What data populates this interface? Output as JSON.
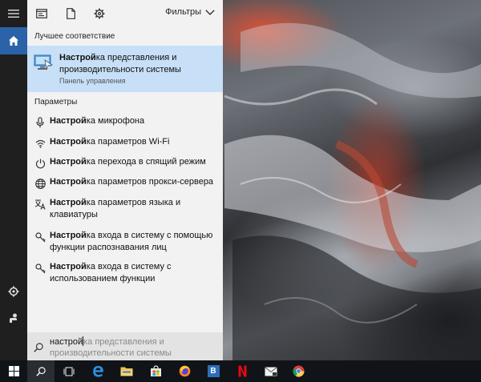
{
  "topbar": {
    "filters_label": "Фильтры"
  },
  "best_match": {
    "section_title": "Лучшее соответствие",
    "title_bold": "Настрой",
    "title_rest": "ка представления и производительности системы",
    "subtitle": "Панель управления"
  },
  "settings": {
    "section_title": "Параметры",
    "items": [
      {
        "bold": "Настрой",
        "rest": "ка микрофона"
      },
      {
        "bold": "Настрой",
        "rest": "ка параметров Wi-Fi"
      },
      {
        "bold": "Настрой",
        "rest": "ка перехода в спящий режим"
      },
      {
        "bold": "Настрой",
        "rest": "ка параметров прокси-сервера"
      },
      {
        "bold": "Настрой",
        "rest": "ка параметров языка и клавиатуры"
      },
      {
        "bold": "Настрой",
        "rest": "ка входа в систему с помощью функции распознавания лиц"
      },
      {
        "bold": "Настрой",
        "rest": "ка входа в систему с использованием функции"
      }
    ]
  },
  "search": {
    "typed": "настрой",
    "ghost": "ка представления и производительности системы"
  },
  "taskbar": {
    "pinned_letter": "B"
  },
  "colors": {
    "accent": "#2a63a8",
    "selection": "#c7dff7",
    "taskbar": "#101418"
  }
}
